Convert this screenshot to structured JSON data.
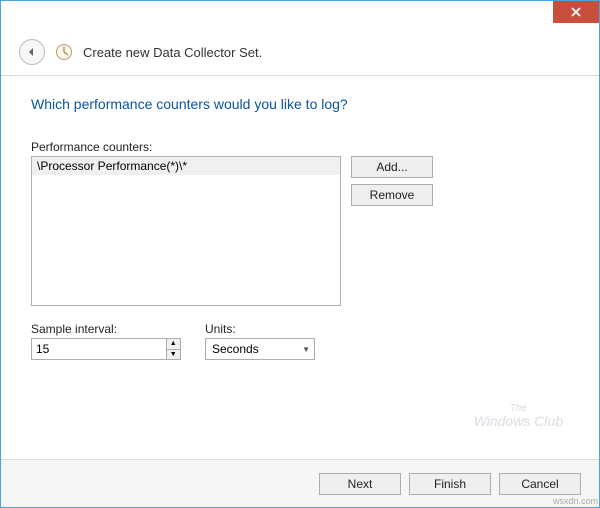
{
  "window": {
    "title": "Create new Data Collector Set."
  },
  "main": {
    "instruction": "Which performance counters would you like to log?",
    "counters_label": "Performance counters:",
    "counters": [
      "\\Processor Performance(*)\\*"
    ],
    "add_label": "Add...",
    "remove_label": "Remove",
    "sample_interval_label": "Sample interval:",
    "sample_interval_value": "15",
    "units_label": "Units:",
    "units_value": "Seconds"
  },
  "footer": {
    "next": "Next",
    "finish": "Finish",
    "cancel": "Cancel"
  },
  "watermark": {
    "line1": "The",
    "line2": "Windows Club"
  },
  "attribution": "wsxdn.com"
}
